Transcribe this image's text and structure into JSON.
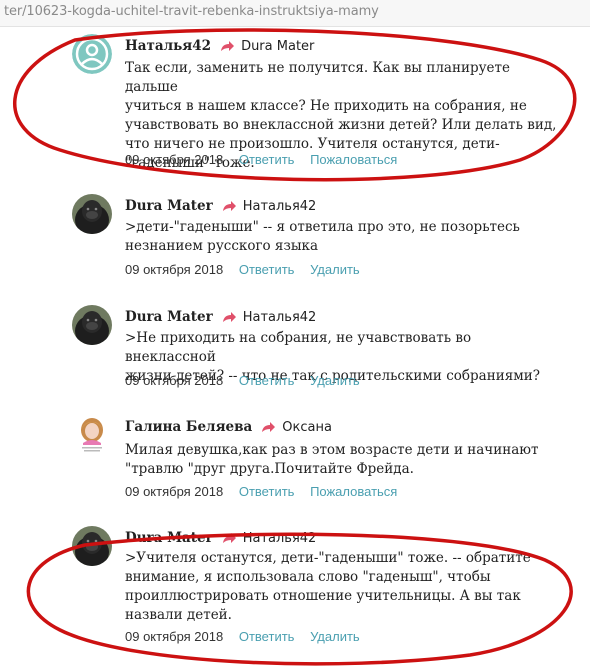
{
  "browser": {
    "url": "ter/10623-kogda-uchitel-travit-rebenka-instruktsiya-mamy"
  },
  "colors": {
    "link": "#4a9fb0",
    "reply_arrow": "#e0506a",
    "annotation": "#cc1111"
  },
  "comments": [
    {
      "author": "Наталья42",
      "reply_to": "Dura Mater",
      "avatar": "teal-user-icon",
      "lines": [
        "Так если, заменить не получится. Как вы планируете дальше",
        "учиться в нашем классе? Не приходить на собрания, не",
        "учавствовать во внеклассной жизни детей? Или делать вид,",
        "что ничего не произошло. Учителя останутся, дети-",
        "\"гаденыши\" тоже."
      ],
      "date": "09 октября 2018",
      "actions": [
        "Ответить",
        "Пожаловаться"
      ]
    },
    {
      "author": "Dura Mater",
      "reply_to": "Наталья42",
      "avatar": "gorilla-photo",
      "lines": [
        ">дети-\"гаденыши\" -- я ответила про это, не позорьтесь",
        "незнанием русского языка"
      ],
      "date": "09 октября 2018",
      "actions": [
        "Ответить",
        "Удалить"
      ]
    },
    {
      "author": "Dura Mater",
      "reply_to": "Наталья42",
      "avatar": "gorilla-photo",
      "lines": [
        ">Не приходить на собрания, не учавствовать во внеклассной",
        "жизни детей? -- что не так с родительскими собраниями?"
      ],
      "date": "09 октября 2018",
      "actions": [
        "Ответить",
        "Удалить"
      ]
    },
    {
      "author": "Галина Беляева",
      "reply_to": "Оксана",
      "avatar": "girl-picture",
      "lines": [
        "Милая девушка,как раз в этом возрасте дети и начинают",
        "\"травлю \"друг друга.Почитайте Фрейда."
      ],
      "date": "09 октября 2018",
      "actions": [
        "Ответить",
        "Пожаловаться"
      ]
    },
    {
      "author": "Dura Mater",
      "reply_to": "Наталья42",
      "avatar": "gorilla-photo",
      "lines": [
        ">Учителя останутся, дети-\"гаденыши\" тоже. -- обратите",
        "внимание, я использовала слово \"гаденыш\", чтобы",
        "проиллюстрировать отношение учительницы. А вы так",
        "назвали детей."
      ],
      "date": "09 октября 2018",
      "actions": [
        "Ответить",
        "Удалить"
      ]
    }
  ]
}
